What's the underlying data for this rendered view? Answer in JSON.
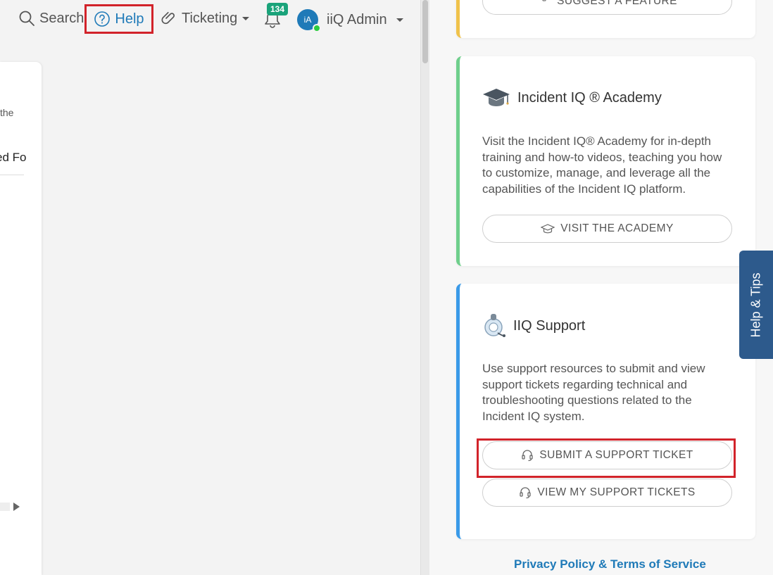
{
  "nav": {
    "search_label": "Search",
    "help_label": "Help",
    "ticketing_label": "Ticketing",
    "notification_count": "134",
    "avatar_initials": "iA",
    "user_name": "iiQ Admin"
  },
  "left_card": {
    "fragment_1": "the",
    "fragment_2": "ed Fo"
  },
  "panel": {
    "feature_card": {
      "button_label": "SUGGEST A FEATURE"
    },
    "academy_card": {
      "title": "Incident IQ ® Academy",
      "description": "Visit the Incident IQ® Academy for in-depth training and how-to videos, teaching you how to customize, manage, and leverage all the capabilities of the Incident IQ platform.",
      "button_label": "VISIT THE ACADEMY"
    },
    "support_card": {
      "title": "IIQ Support",
      "description": "Use support resources to submit and view support tickets regarding technical and troubleshooting questions related to the Incident IQ system.",
      "submit_label": "SUBMIT A SUPPORT TICKET",
      "view_label": "VIEW MY SUPPORT TICKETS"
    },
    "footer_link": "Privacy Policy & Terms of Service"
  },
  "help_tab": {
    "label": "Help & Tips"
  },
  "colors": {
    "accent_blue": "#1f7ab8",
    "highlight_red": "#d2232a",
    "feature_border": "#f0c24b",
    "academy_border": "#6fcf8c",
    "support_border": "#3a9ae8",
    "help_tab_bg": "#2d5a8c",
    "badge_green": "#1aa37a"
  },
  "icons": {
    "search": "search-icon",
    "help": "question-circle-icon",
    "ticketing": "paperclip-icon",
    "notifications": "bell-icon",
    "user_menu": "caret-down-icon",
    "feature": "lightbulb-icon",
    "academy": "graduation-cap-icon",
    "support": "headset-icon"
  }
}
